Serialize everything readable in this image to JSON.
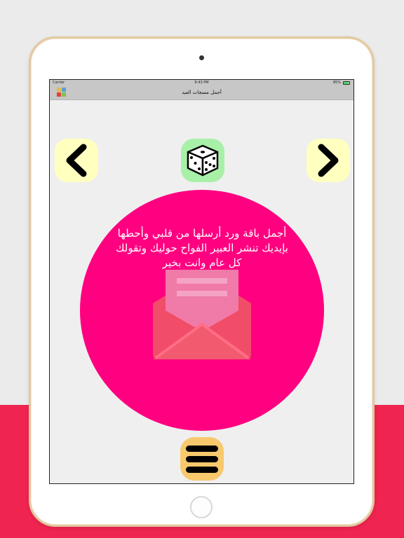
{
  "device": {
    "status_bar": {
      "carrier": "Carrier",
      "time": "9:43 PM",
      "battery_percent": "85%",
      "battery_level": 0.85
    },
    "nav_bar": {
      "title": "أجمل مسجات العيد"
    }
  },
  "controls": {
    "prev_icon": "chevron-left-icon",
    "next_icon": "chevron-right-icon",
    "dice_icon": "dice-icon",
    "menu_icon": "hamburger-menu-icon"
  },
  "card": {
    "message": "أجمل باقة ورد أرسلها من قلبي وأحطها\nبإيديك تنشر العبير الفواح حوليك وتقولك\nكل عام وانت بخير",
    "icon": "open-envelope-icon"
  },
  "colors": {
    "page_background": "#ebebeb",
    "bottom_band": "#ef2450",
    "circle": "#ff0080",
    "arrow_button_bg": "#ffffc0",
    "dice_button_bg": "#a8f0a8",
    "menu_button_bg": "#f7c96c"
  }
}
